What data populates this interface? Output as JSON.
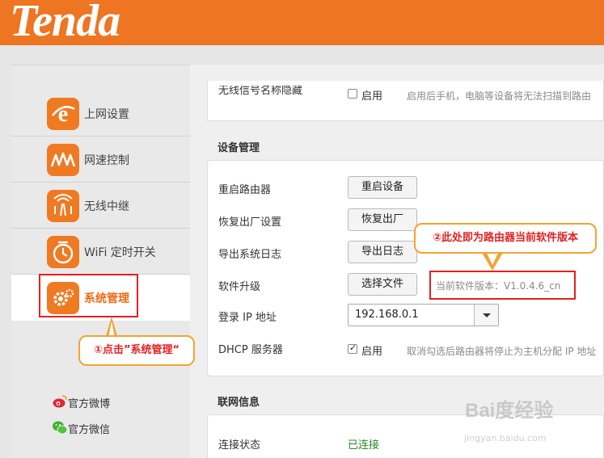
{
  "brand": {
    "logo": "Tenda",
    "accent": "#ee7522"
  },
  "sidebar": {
    "items": [
      {
        "label": "上网设置",
        "icon": "internet-e-icon"
      },
      {
        "label": "网速控制",
        "icon": "speed-wave-icon"
      },
      {
        "label": "无线中继",
        "icon": "wireless-repeater-icon"
      },
      {
        "label": "WiFi 定时开关",
        "icon": "wifi-timer-icon"
      },
      {
        "label": "系统管理",
        "icon": "gear-icon",
        "active": true
      }
    ],
    "social": [
      {
        "label": "官方微博",
        "icon": "weibo-icon"
      },
      {
        "label": "官方微信",
        "icon": "wechat-icon"
      }
    ]
  },
  "wireless": {
    "hide_ssid_label": "无线信号名称隐藏",
    "enable_label": "启用",
    "hint": "启用后手机，电脑等设备将无法扫描到路由"
  },
  "device": {
    "title": "设备管理",
    "reboot_label": "重启路由器",
    "reboot_button": "重启设备",
    "reset_label": "恢复出厂设置",
    "reset_button": "恢复出厂",
    "log_label": "导出系统日志",
    "log_button": "导出日志",
    "upgrade_label": "软件升级",
    "upgrade_button": "选择文件",
    "version_text": "当前软件版本：V1.0.4.6_cn",
    "login_ip_label": "登录 IP 地址",
    "login_ip_value": "192.168.0.1",
    "dhcp_label": "DHCP 服务器",
    "dhcp_enable": "启用",
    "dhcp_hint": "取消勾选后路由器将停止为主机分配 IP 地址"
  },
  "network": {
    "title": "联网信息",
    "status_label": "连接状态",
    "status_value": "已连接"
  },
  "annotations": {
    "click_hint": "①点击”系统管理“",
    "version_hint": "②此处即为路由器当前软件版本"
  },
  "watermark": {
    "main": "Bai度经验",
    "sub": "jingyan.baidu.com"
  }
}
